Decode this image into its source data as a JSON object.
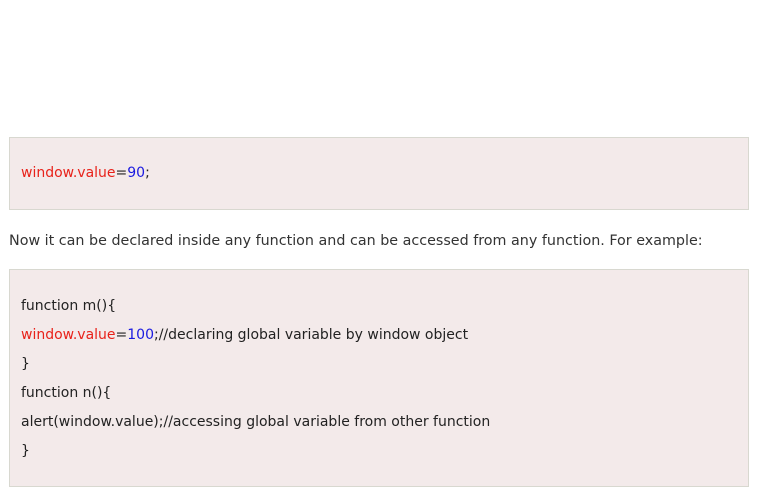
{
  "snippet1": {
    "obj": "window.value",
    "eq": "=",
    "num": "90",
    "end": ";"
  },
  "paragraph": "Now it can be declared inside any function and can be accessed from any function. For example:",
  "snippet2": {
    "line1": "function m(){",
    "line2_obj": "window.value",
    "line2_eq": "=",
    "line2_num": "100",
    "line2_rest": ";//declaring global variable by window object",
    "line3": "}",
    "line4": "function n(){",
    "line5": "alert(window.value);//accessing global variable from other function",
    "line6": "}"
  },
  "colors": {
    "code_background": "#f3eaea",
    "keyword_red": "#e8221a",
    "number_blue": "#1a1ae0"
  }
}
